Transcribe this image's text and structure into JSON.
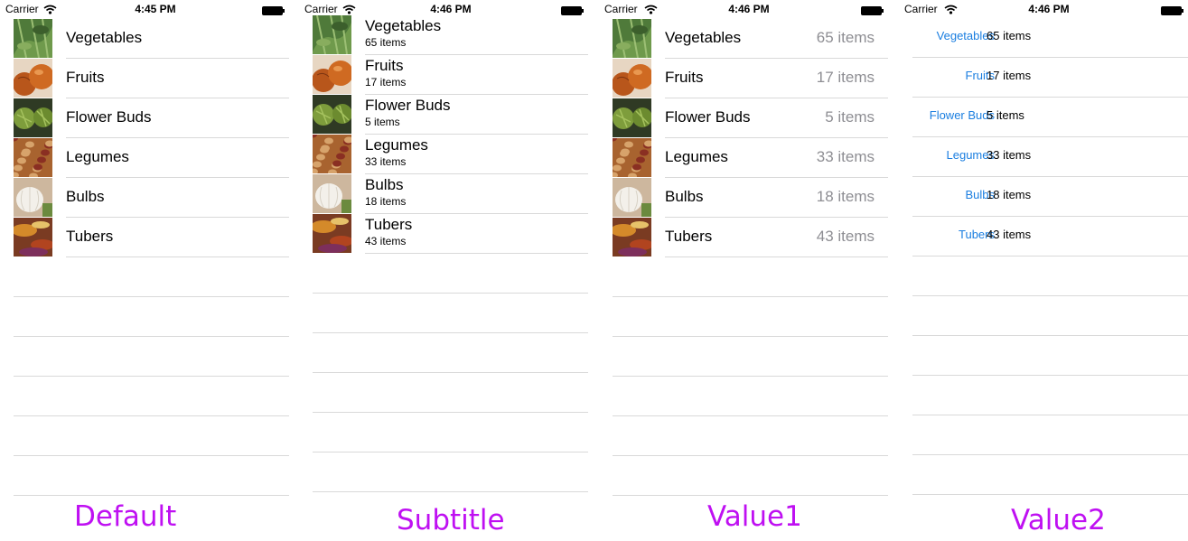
{
  "colors": {
    "caption": "#bf10f2",
    "value2_title": "#1a7ee0",
    "value1_detail": "#8e8e93",
    "separator": "#d9d9d9"
  },
  "rows": [
    {
      "title": "Vegetables",
      "detail": "65 items",
      "thumb": "vegetables-thumbnail"
    },
    {
      "title": "Fruits",
      "detail": "17 items",
      "thumb": "fruits-thumbnail"
    },
    {
      "title": "Flower Buds",
      "detail": "5 items",
      "thumb": "flower-buds-thumbnail"
    },
    {
      "title": "Legumes",
      "detail": "33 items",
      "thumb": "legumes-thumbnail"
    },
    {
      "title": "Bulbs",
      "detail": "18 items",
      "thumb": "bulbs-thumbnail"
    },
    {
      "title": "Tubers",
      "detail": "43 items",
      "thumb": "tubers-thumbnail"
    }
  ],
  "screens": [
    {
      "style": "default",
      "carrier": "Carrier",
      "time": "4:45 PM",
      "caption": "Default"
    },
    {
      "style": "subtitle",
      "carrier": "Carrier",
      "time": "4:46 PM",
      "caption": "Subtitle"
    },
    {
      "style": "value1",
      "carrier": "Carrier",
      "time": "4:46 PM",
      "caption": "Value1"
    },
    {
      "style": "value2",
      "carrier": "Carrier",
      "time": "4:46 PM",
      "caption": "Value2"
    }
  ]
}
